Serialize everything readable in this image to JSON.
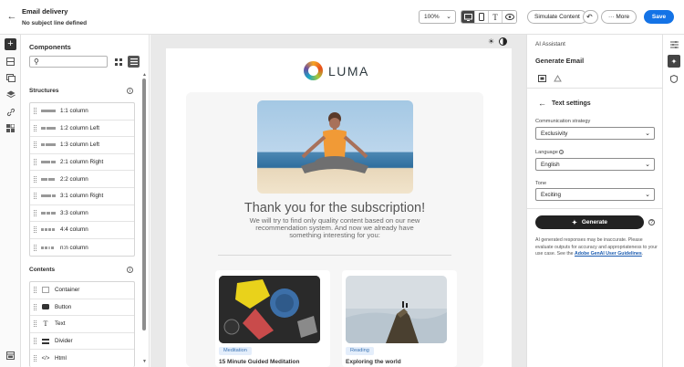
{
  "header": {
    "title": "Email delivery",
    "subtitle": "No subject line defined",
    "zoom": "100%",
    "simulate_label": "Simulate Content",
    "more_label": "More",
    "save_label": "Save"
  },
  "components": {
    "heading": "Components",
    "search_placeholder": "",
    "structures_heading": "Structures",
    "structures": [
      "1:1 column",
      "1:2 column Left",
      "1:3 column Left",
      "2:1 column Right",
      "2:2 column",
      "3:1 column Right",
      "3:3 column",
      "4:4 column",
      "n:n column"
    ],
    "contents_heading": "Contents",
    "contents": [
      {
        "label": "Container",
        "icon": "container-icon"
      },
      {
        "label": "Button",
        "icon": "button-icon"
      },
      {
        "label": "Text",
        "icon": "text-icon"
      },
      {
        "label": "Divider",
        "icon": "divider-icon"
      },
      {
        "label": "Html",
        "icon": "html-icon"
      }
    ]
  },
  "email": {
    "logo_text": "LUMA",
    "thanks": "Thank you for the subscription!",
    "lead": "We will try to find only quality content based on our new recommendation system. And now we already have something interesting for you:",
    "cards": [
      {
        "tag": "Meditation",
        "title": "15 Minute Guided Meditation"
      },
      {
        "tag": "Reading",
        "title": "Exploring the world"
      }
    ]
  },
  "assistant": {
    "panel_title": "AI Assistant",
    "section_title": "Generate Email",
    "text_settings": "Text settings",
    "strategy_label": "Communication strategy",
    "strategy_value": "Exclusivity",
    "language_label": "Language",
    "language_value": "English",
    "tone_label": "Tone",
    "tone_value": "Exciting",
    "generate_label": "Generate",
    "disclaimer": "AI generated responses may be inaccurate. Please evaluate outputs for accuracy and appropriateness to your use case. See the ",
    "link_text": "Adobe GenAI User Guidelines",
    "disclaimer_end": "."
  },
  "colors": {
    "accent": "#1473e6",
    "dark_button": "#222222",
    "tag_bg": "#e4eefb"
  }
}
